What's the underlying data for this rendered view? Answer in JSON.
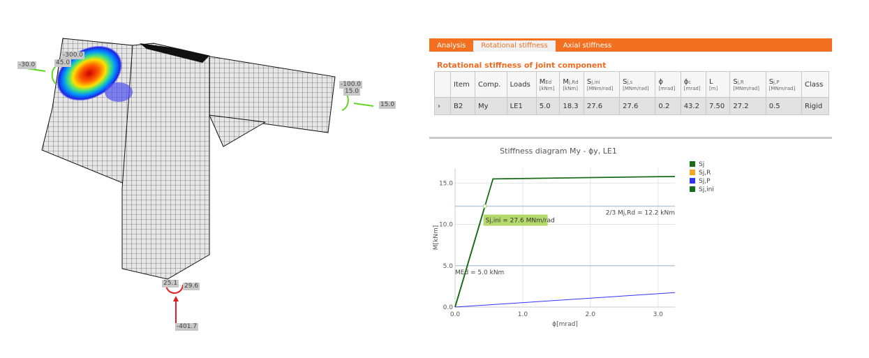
{
  "model": {
    "labels": [
      "-30.0",
      "-300.0",
      "45.0",
      "-100.0",
      "15.0",
      "15.0",
      "25.1",
      "29.6",
      "-401.7"
    ]
  },
  "tabs": [
    {
      "label": "Analysis",
      "active": false
    },
    {
      "label": "Rotational stiffness",
      "active": true
    },
    {
      "label": "Axial stiffness",
      "active": false
    }
  ],
  "section_title": "Rotational stiffness of joint component",
  "table": {
    "headers": [
      {
        "main": "",
        "sub": "",
        "unit": ""
      },
      {
        "main": "Item",
        "sub": "",
        "unit": ""
      },
      {
        "main": "Comp.",
        "sub": "",
        "unit": ""
      },
      {
        "main": "Loads",
        "sub": "",
        "unit": ""
      },
      {
        "main": "M",
        "sub": "Ed",
        "unit": "[kNm]"
      },
      {
        "main": "M",
        "sub": "j,Rd",
        "unit": "[kNm]"
      },
      {
        "main": "S",
        "sub": "j,ini",
        "unit": "[MNm/rad]"
      },
      {
        "main": "S",
        "sub": "j,s",
        "unit": "[MNm/rad]"
      },
      {
        "main": "ϕ",
        "sub": "",
        "unit": "[mrad]"
      },
      {
        "main": "ϕ",
        "sub": "c",
        "unit": "[mrad]"
      },
      {
        "main": "L",
        "sub": "",
        "unit": "[m]"
      },
      {
        "main": "S",
        "sub": "j,R",
        "unit": "[MNm/rad]"
      },
      {
        "main": "S",
        "sub": "j,P",
        "unit": "[MNm/rad]"
      },
      {
        "main": "Class",
        "sub": "",
        "unit": ""
      }
    ],
    "rows": [
      [
        "›",
        "B2",
        "My",
        "LE1",
        "5.0",
        "18.3",
        "27.6",
        "27.6",
        "0.2",
        "43.2",
        "7.50",
        "27.2",
        "0.5",
        "Rigid"
      ]
    ]
  },
  "chart_data": {
    "type": "line",
    "title": "Stiffness diagram My - ϕy, LE1",
    "xlabel": "ϕ[mrad]",
    "ylabel": "M[kNm]",
    "xlim": [
      0,
      3.25
    ],
    "ylim": [
      0,
      16.8
    ],
    "xticks": [
      0,
      1,
      2,
      3
    ],
    "xtick_labels": [
      "0.0",
      "1.0",
      "2.0",
      "3.0"
    ],
    "yticks": [
      0,
      5,
      10,
      15
    ],
    "ytick_labels": [
      "0.0",
      "5.0",
      "10.0",
      "15.0"
    ],
    "grid": true,
    "legend_position": "right",
    "series": [
      {
        "name": "Sj",
        "color": "#1a6b1a",
        "x": [
          0,
          0.56,
          3.25
        ],
        "y": [
          0,
          15.5,
          15.8
        ]
      },
      {
        "name": "Sj,R",
        "color": "#f5a623",
        "x": [],
        "y": []
      },
      {
        "name": "Sj,P",
        "color": "#3333ff",
        "x": [
          0,
          3.25
        ],
        "y": [
          0,
          1.75
        ]
      },
      {
        "name": "Sj,ini",
        "color": "#1a6b1a",
        "x": [
          0,
          0.44
        ],
        "y": [
          0,
          12.2
        ]
      }
    ],
    "hlines": [
      {
        "y": 12.2,
        "label": "2/3 Mj,Rd = 12.2 kNm"
      },
      {
        "y": 5.0,
        "label": "MEd = 5.0 kNm"
      }
    ],
    "annotation": {
      "x": 0.44,
      "y": 12.2,
      "text": "Sj,ini = 27.6 MNm/rad"
    }
  }
}
